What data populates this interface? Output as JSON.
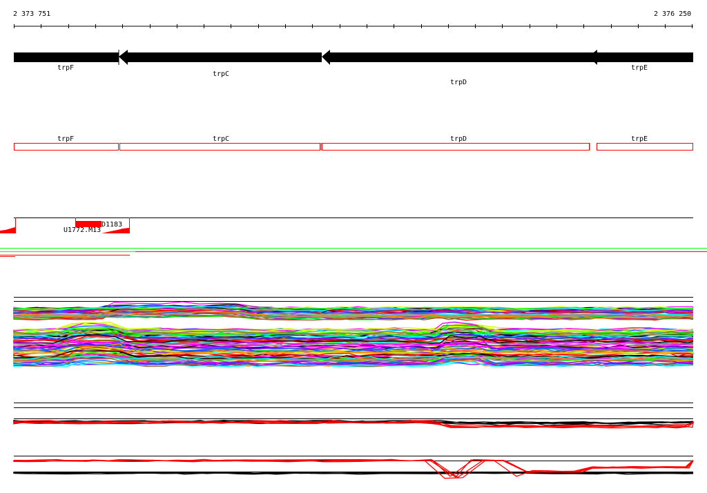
{
  "ruler": {
    "start_label": "2 373 751",
    "end_label": "2 376 250"
  },
  "genes": [
    {
      "name": "trpF",
      "strand": "-"
    },
    {
      "name": "trpC",
      "strand": "-"
    },
    {
      "name": "trpD",
      "strand": "-"
    },
    {
      "name": "trpE",
      "strand": "-"
    }
  ],
  "cds_track": {
    "labels": [
      "trpF",
      "trpC",
      "trpD",
      "trpE"
    ],
    "color": "#ff0000"
  },
  "features": [
    {
      "name": "U1772.M13"
    },
    {
      "name": "D1183"
    }
  ],
  "colors": {
    "gene": "#000000",
    "feature": "#ff0000",
    "match": "#00ff00",
    "mismatch": "#ff0000"
  }
}
